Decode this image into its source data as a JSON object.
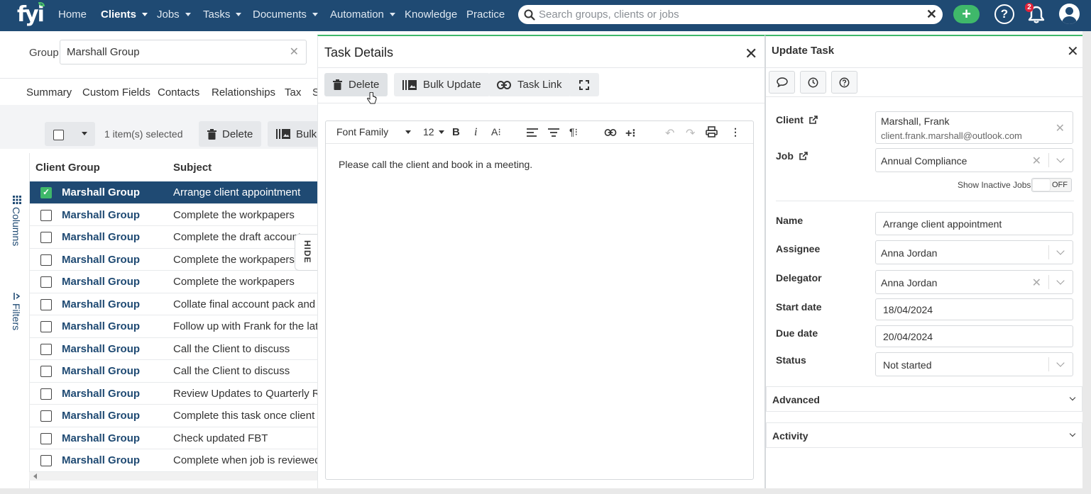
{
  "nav": {
    "logo": "fyi",
    "items": [
      {
        "label": "Home",
        "dropdown": false
      },
      {
        "label": "Clients",
        "dropdown": true,
        "active": true
      },
      {
        "label": "Jobs",
        "dropdown": true
      },
      {
        "label": "Tasks",
        "dropdown": true
      },
      {
        "label": "Documents",
        "dropdown": true
      },
      {
        "label": "Automation",
        "dropdown": true
      },
      {
        "label": "Knowledge",
        "dropdown": false
      },
      {
        "label": "Practice",
        "dropdown": false
      }
    ],
    "search_placeholder": "Search groups, clients or jobs",
    "add_label": "+",
    "help_label": "?",
    "notification_count": "2"
  },
  "client_page": {
    "group_label": "Group",
    "group_value": "Marshall Group",
    "tabs": [
      "Summary",
      "Custom Fields",
      "Contacts",
      "Relationships",
      "Tax",
      "S"
    ],
    "selected_count": "1 item(s) selected",
    "delete_label": "Delete",
    "bulk_label": "Bulk",
    "columns": {
      "client_group": "Client Group",
      "subject": "Subject"
    },
    "rail_columns": "Columns",
    "rail_filters": "Filters",
    "hide_label": "HIDE",
    "rows": [
      {
        "group": "Marshall Group",
        "subject": "Arrange client appointment",
        "selected": true
      },
      {
        "group": "Marshall Group",
        "subject": "Complete the workpapers"
      },
      {
        "group": "Marshall Group",
        "subject": "Complete the draft accounts"
      },
      {
        "group": "Marshall Group",
        "subject": "Complete the workpapers"
      },
      {
        "group": "Marshall Group",
        "subject": "Complete the workpapers"
      },
      {
        "group": "Marshall Group",
        "subject": "Collate final account pack and sig"
      },
      {
        "group": "Marshall Group",
        "subject": "Follow up with Frank for the latest"
      },
      {
        "group": "Marshall Group",
        "subject": "Call the Client to discuss"
      },
      {
        "group": "Marshall Group",
        "subject": "Call the Client to discuss"
      },
      {
        "group": "Marshall Group",
        "subject": "Review Updates to Quarterly Retu"
      },
      {
        "group": "Marshall Group",
        "subject": "Complete this task once client doc"
      },
      {
        "group": "Marshall Group",
        "subject": "Check updated FBT"
      },
      {
        "group": "Marshall Group",
        "subject": "Complete when job is reviewed ar"
      }
    ]
  },
  "task_details": {
    "title": "Task Details",
    "buttons": {
      "delete": "Delete",
      "bulk_update": "Bulk Update",
      "task_link": "Task Link"
    },
    "editor": {
      "font_family": "Font Family",
      "font_size": "12",
      "content": "Please call the client and book in a meeting."
    }
  },
  "update_task": {
    "title": "Update Task",
    "client_label": "Client",
    "client_name": "Marshall, Frank",
    "client_email": "client.frank.marshall@outlook.com",
    "job_label": "Job",
    "job_value": "Annual Compliance",
    "show_inactive_label": "Show Inactive Jobs",
    "toggle_label": "OFF",
    "name_label": "Name",
    "name_value": "Arrange client appointment",
    "assignee_label": "Assignee",
    "assignee_value": "Anna Jordan",
    "delegator_label": "Delegator",
    "delegator_value": "Anna Jordan",
    "start_label": "Start date",
    "start_value": "18/04/2024",
    "due_label": "Due date",
    "due_value": "20/04/2024",
    "status_label": "Status",
    "status_value": "Not started",
    "advanced_label": "Advanced",
    "activity_label": "Activity"
  },
  "colors": {
    "nav_bg": "#1f4a73",
    "accent_green": "#3fb86a",
    "selected_row": "#1f4a73",
    "badge_red": "#e0233a"
  }
}
